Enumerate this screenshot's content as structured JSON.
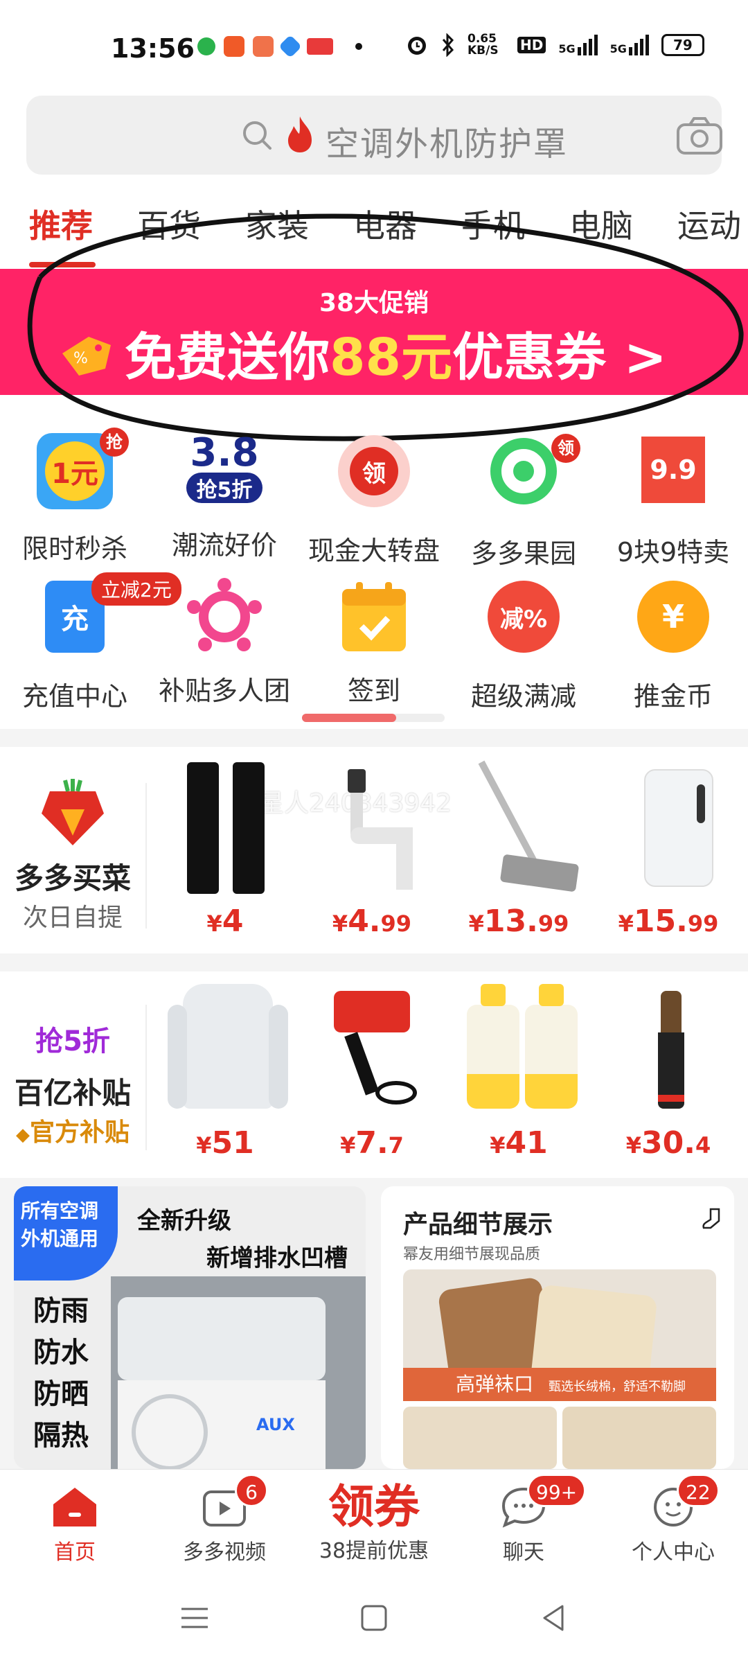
{
  "status": {
    "time": "13:56",
    "network_speed": "0.65 KB/S",
    "hd": "HD",
    "signal1": "5G",
    "signal2": "5G",
    "battery": "79"
  },
  "search": {
    "placeholder": "空调外机防护罩"
  },
  "tabs": [
    {
      "label": "推荐"
    },
    {
      "label": "百货"
    },
    {
      "label": "家装"
    },
    {
      "label": "电器"
    },
    {
      "label": "手机"
    },
    {
      "label": "电脑"
    },
    {
      "label": "运动"
    }
  ],
  "banner": {
    "subtitle": "38大促销",
    "main_prefix": "免费送你",
    "main_highlight": "88元",
    "main_suffix": "优惠券 >"
  },
  "grid": [
    {
      "label": "限时秒杀",
      "badge": "抢",
      "icon_text": "1元"
    },
    {
      "label": "潮流好价",
      "icon_text": "3.8",
      "icon_sub": "抢5折"
    },
    {
      "label": "现金大转盘",
      "icon_text": "领"
    },
    {
      "label": "多多果园",
      "badge": "领"
    },
    {
      "label": "9块9特卖",
      "icon_text": "9.9"
    },
    {
      "label": "充值中心",
      "badge": "立减2元",
      "icon_text": "充"
    },
    {
      "label": "补贴多人团"
    },
    {
      "label": "签到"
    },
    {
      "label": "超级满减",
      "icon_text": "减%"
    },
    {
      "label": "推金币",
      "icon_text": "¥"
    }
  ],
  "row1": {
    "title": "多多买菜",
    "subtitle": "次日自提",
    "watermark": "曼星人240343942",
    "items": [
      {
        "cur": "¥",
        "int": "4",
        "dec": ""
      },
      {
        "cur": "¥",
        "int": "4.",
        "dec": "99"
      },
      {
        "cur": "¥",
        "int": "13.",
        "dec": "99"
      },
      {
        "cur": "¥",
        "int": "15.",
        "dec": "99"
      }
    ]
  },
  "row2": {
    "tag": "抢5折",
    "title": "百亿补贴",
    "subtitle": "官方补贴",
    "items": [
      {
        "cur": "¥",
        "int": "51",
        "dec": ""
      },
      {
        "cur": "¥",
        "int": "7.",
        "dec": "7"
      },
      {
        "cur": "¥",
        "int": "41",
        "dec": ""
      },
      {
        "cur": "¥",
        "int": "30.",
        "dec": "4"
      }
    ]
  },
  "feed": {
    "card1": {
      "tag": "所有空调外机通用",
      "head1": "全新升级",
      "head2": "新增排水凹槽",
      "features": [
        "防雨",
        "防水",
        "防晒",
        "隔热"
      ],
      "brand": "AUX"
    },
    "card2": {
      "title": "产品细节展示",
      "subtitle": "幂友用细节展现品质",
      "strip_main": "高弹袜口",
      "strip_sub": "甄选长绒棉，舒适不勒脚"
    }
  },
  "bottom_nav": [
    {
      "label": "首页"
    },
    {
      "label": "多多视频",
      "badge": "6"
    },
    {
      "label": "38提前优惠",
      "big": "领券"
    },
    {
      "label": "聊天",
      "badge": "99+"
    },
    {
      "label": "个人中心",
      "badge": "22"
    }
  ]
}
